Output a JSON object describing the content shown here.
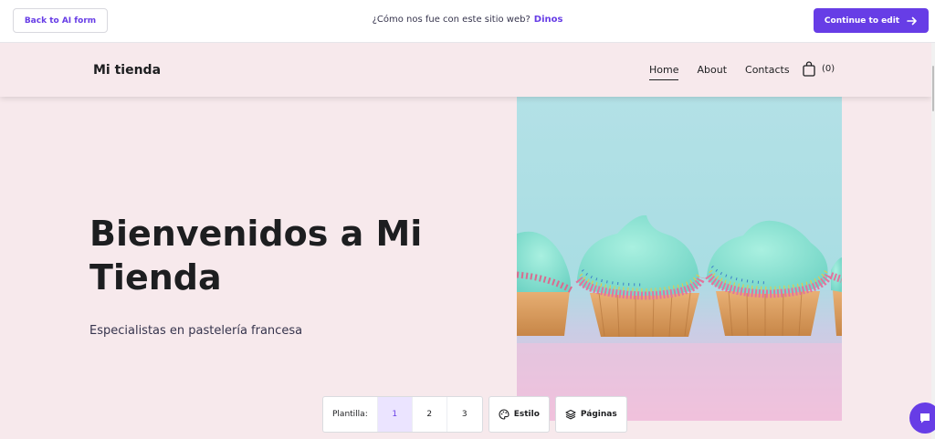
{
  "topbar": {
    "back_label": "Back to AI form",
    "feedback_text": "¿Cómo nos fue con este sitio web?",
    "feedback_link": "Dinos",
    "continue_label": "Continue to edit"
  },
  "site": {
    "logo": "Mi tienda",
    "nav": [
      {
        "label": "Home",
        "active": true
      },
      {
        "label": "About",
        "active": false
      },
      {
        "label": "Contacts",
        "active": false
      }
    ],
    "cart_count": "(0)",
    "hero_title": "Bienvenidos a Mi Tienda",
    "hero_subtitle": "Especialistas en pastelería francesa",
    "hero_image_icon": "cupcakes-photo"
  },
  "toolbar": {
    "template_label": "Plantilla:",
    "templates": [
      "1",
      "2",
      "3"
    ],
    "selected_template": "1",
    "style_label": "Estilo",
    "pages_label": "Páginas"
  },
  "colors": {
    "accent": "#673de6",
    "site_bg": "#f7e9ec"
  }
}
